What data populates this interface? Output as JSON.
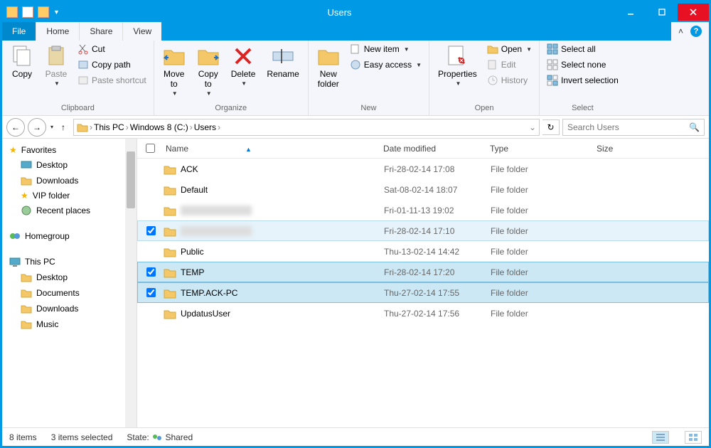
{
  "window": {
    "title": "Users"
  },
  "tabs": {
    "file": "File",
    "home": "Home",
    "share": "Share",
    "view": "View"
  },
  "ribbon": {
    "clipboard": {
      "label": "Clipboard",
      "copy": "Copy",
      "paste": "Paste",
      "cut": "Cut",
      "copy_path": "Copy path",
      "paste_shortcut": "Paste shortcut"
    },
    "organize": {
      "label": "Organize",
      "move": "Move\nto",
      "copy": "Copy\nto",
      "delete": "Delete",
      "rename": "Rename"
    },
    "new": {
      "label": "New",
      "new_folder": "New\nfolder",
      "new_item": "New item",
      "easy_access": "Easy access"
    },
    "open": {
      "label": "Open",
      "properties": "Properties",
      "open": "Open",
      "edit": "Edit",
      "history": "History"
    },
    "select": {
      "label": "Select",
      "select_all": "Select all",
      "select_none": "Select none",
      "invert": "Invert selection"
    }
  },
  "breadcrumb": {
    "items": [
      "This PC",
      "Windows 8 (C:)",
      "Users"
    ]
  },
  "search": {
    "placeholder": "Search Users"
  },
  "sidebar": {
    "favorites": "Favorites",
    "fav_items": [
      "Desktop",
      "Downloads",
      "VIP folder",
      "Recent places"
    ],
    "homegroup": "Homegroup",
    "this_pc": "This PC",
    "pc_items": [
      "Desktop",
      "Documents",
      "Downloads",
      "Music"
    ]
  },
  "columns": {
    "name": "Name",
    "date": "Date modified",
    "type": "Type",
    "size": "Size"
  },
  "files": [
    {
      "name": "ACK",
      "date": "Fri-28-02-14 17:08",
      "type": "File folder",
      "checked": false,
      "selected": false,
      "blurred": false
    },
    {
      "name": "Default",
      "date": "Sat-08-02-14 18:07",
      "type": "File folder",
      "checked": false,
      "selected": false,
      "blurred": false
    },
    {
      "name": "________",
      "date": "Fri-01-11-13 19:02",
      "type": "File folder",
      "checked": false,
      "selected": false,
      "blurred": true
    },
    {
      "name": "____________",
      "date": "Fri-28-02-14 17:10",
      "type": "File folder",
      "checked": true,
      "selected": "light",
      "blurred": true
    },
    {
      "name": "Public",
      "date": "Thu-13-02-14 14:42",
      "type": "File folder",
      "checked": false,
      "selected": false,
      "blurred": false
    },
    {
      "name": "TEMP",
      "date": "Fri-28-02-14 17:20",
      "type": "File folder",
      "checked": true,
      "selected": true,
      "blurred": false
    },
    {
      "name": "TEMP.ACK-PC",
      "date": "Thu-27-02-14 17:55",
      "type": "File folder",
      "checked": true,
      "selected": true,
      "blurred": false
    },
    {
      "name": "UpdatusUser",
      "date": "Thu-27-02-14 17:56",
      "type": "File folder",
      "checked": false,
      "selected": false,
      "blurred": false
    }
  ],
  "status": {
    "count": "8 items",
    "selected": "3 items selected",
    "state_label": "State:",
    "state_value": "Shared"
  }
}
